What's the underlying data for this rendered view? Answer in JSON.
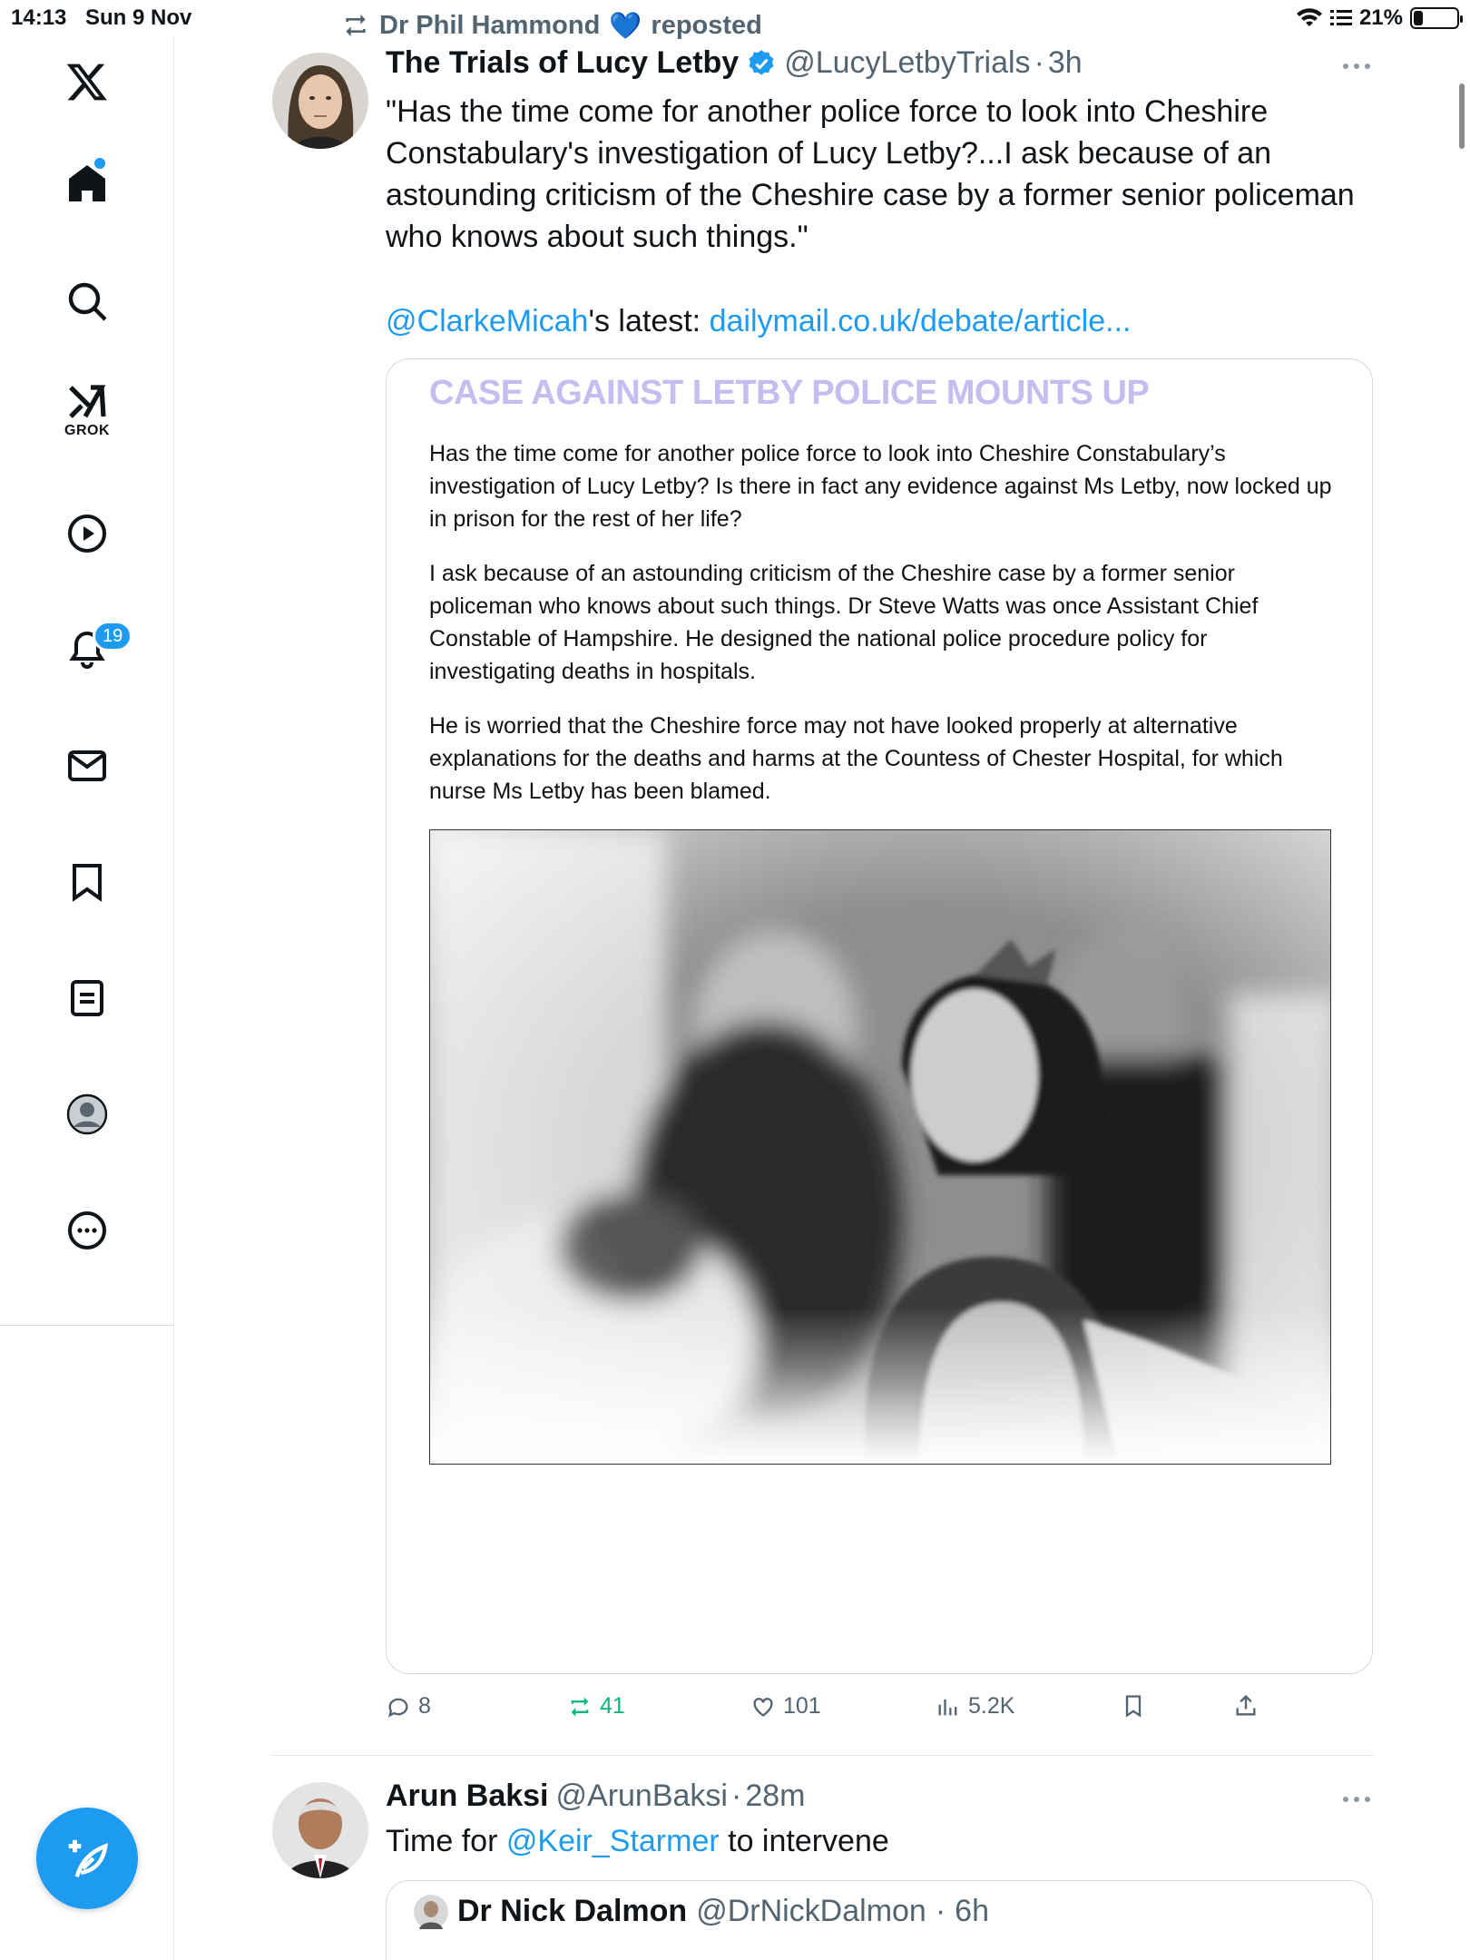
{
  "status_bar": {
    "time": "14:13",
    "date": "Sun 9 Nov",
    "battery": "21%",
    "battery_level": 0.21
  },
  "sidebar": {
    "items": [
      {
        "name": "x-logo-icon"
      },
      {
        "name": "home-icon"
      },
      {
        "name": "search-icon"
      },
      {
        "name": "grok-icon",
        "label": "GROK"
      },
      {
        "name": "video-icon"
      },
      {
        "name": "notifications-icon",
        "badge": "19"
      },
      {
        "name": "messages-icon"
      },
      {
        "name": "bookmarks-icon"
      },
      {
        "name": "lists-icon"
      },
      {
        "name": "profile-icon"
      },
      {
        "name": "more-icon"
      }
    ],
    "compose": {
      "name": "compose-icon"
    }
  },
  "tweet": {
    "repost_by": "Dr Phil Hammond",
    "repost_emoji": "💙",
    "repost_suffix": "reposted",
    "author_name": "The Trials of Lucy Letby",
    "author_handle": "@LucyLetbyTrials",
    "age": "3h",
    "text": "\"Has the time come for another police force to look into Cheshire Constabulary's investigation of Lucy Letby?...I ask because of an astounding criticism of the Cheshire case by a former senior policeman who knows about such things.\"",
    "mention": "@ClarkeMicah",
    "mention_suffix": "'s latest: ",
    "link": "dailymail.co.uk/debate/article...",
    "card": {
      "title": "CASE AGAINST LETBY POLICE MOUNTS UP",
      "paragraphs": [
        "Has the time come for another police force to look into Cheshire Constabulary’s investigation of Lucy Letby? Is there in fact any evidence against Ms Letby, now locked up in prison for the rest of her life?",
        "I ask because of an astounding criticism of the Cheshire case by a former senior policeman who knows about such things. Dr Steve Watts was once Assistant Chief Constable of Hampshire. He designed the national police procedure policy for investigating deaths in hospitals.",
        "He is worried that the Cheshire force may not have looked properly at alternative explanations for the deaths and harms at the Countess of Chester Hospital, for which nurse Ms Letby has been blamed."
      ]
    },
    "stats": {
      "replies": "8",
      "reposts": "41",
      "likes": "101",
      "views": "5.2K"
    }
  },
  "reply": {
    "author_name": "Arun Baksi",
    "author_handle": "@ArunBaksi",
    "age": "28m",
    "text_prefix": "Time for ",
    "mention": "@Keir_Starmer",
    "text_suffix": " to intervene",
    "quote": {
      "author_name": "Dr Nick Dalmon",
      "author_handle": "@DrNickDalmon",
      "age": "6h"
    }
  },
  "colors": {
    "accent": "#1d9bf0",
    "repost_green": "#00ba7c",
    "card_title": "#c5bdf0",
    "muted": "#536471"
  }
}
